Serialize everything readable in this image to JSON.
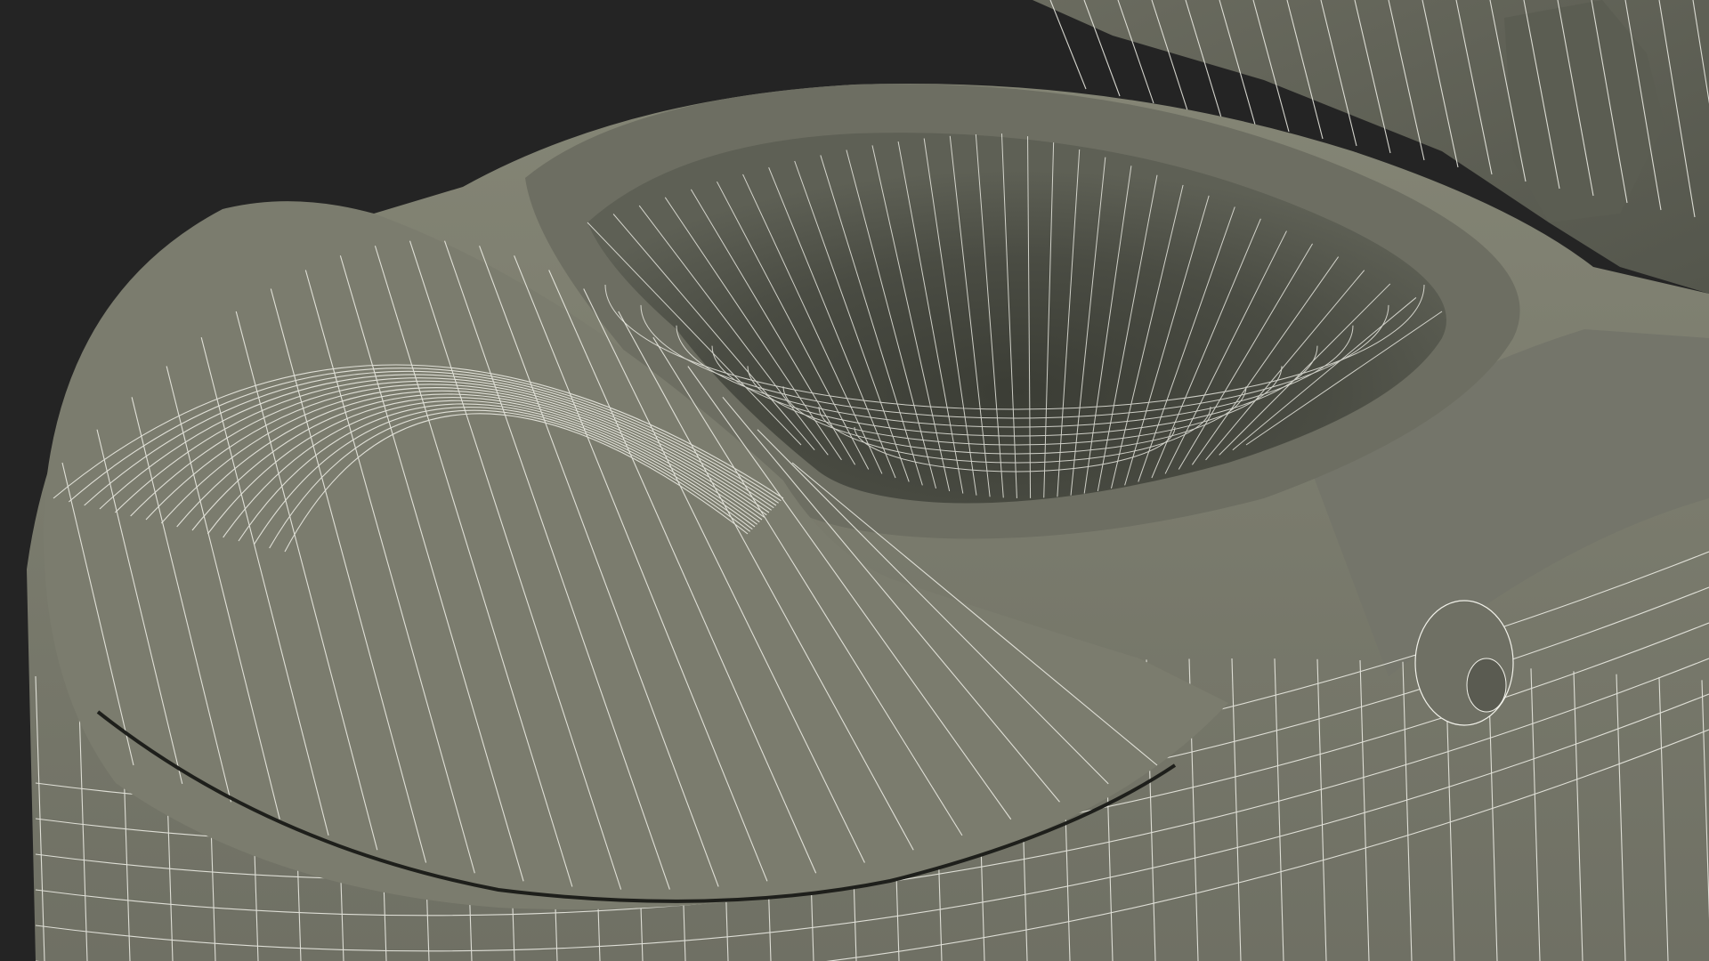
{
  "scene": {
    "subject": "toilet-wireframe-model",
    "colors": {
      "background": "#242424",
      "surface": "#7a7b6d",
      "surface_light": "#838474",
      "surface_dark": "#5f6055",
      "interior_deep": "#3d3f37",
      "interior_mid": "#4e5046",
      "wire": "#f2f2ea",
      "seam": "#1e1f1b"
    }
  }
}
